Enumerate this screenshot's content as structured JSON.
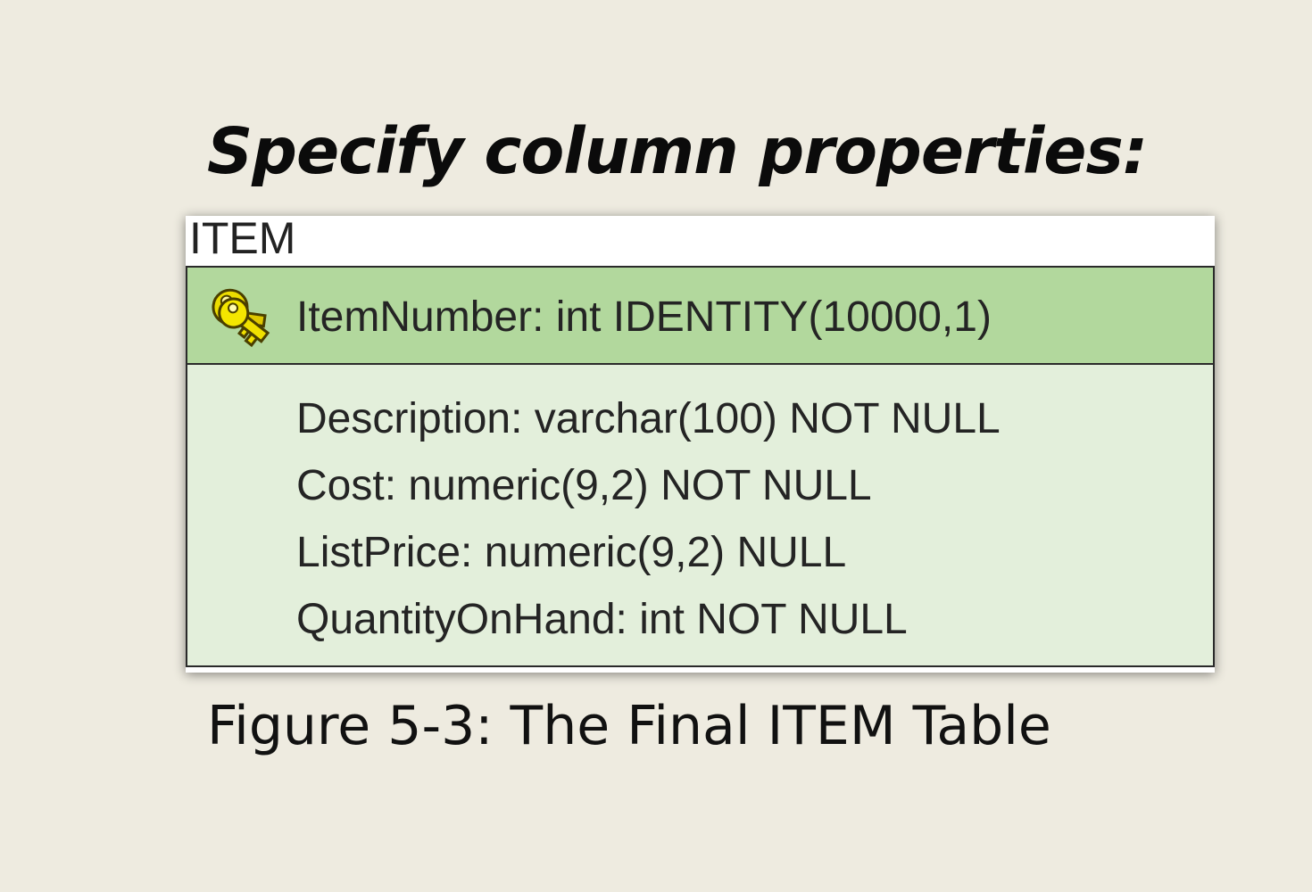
{
  "slide": {
    "title": "Specify column properties:",
    "caption": "Figure 5-3:  The Final ITEM Table"
  },
  "table": {
    "name": "ITEM",
    "primary_key": {
      "text": "ItemNumber: int IDENTITY(10000,1)",
      "icon": "key-icon"
    },
    "attributes": [
      "Description: varchar(100) NOT NULL",
      "Cost: numeric(9,2) NOT NULL",
      "ListPrice: numeric(9,2) NULL",
      "QuantityOnHand: int NOT NULL"
    ]
  },
  "colors": {
    "background": "#eeebe0",
    "key_row": "#b2d89d",
    "attribute_area": "#e3efdb",
    "border": "#2a2a2a",
    "key_icon": "#e8d900"
  }
}
